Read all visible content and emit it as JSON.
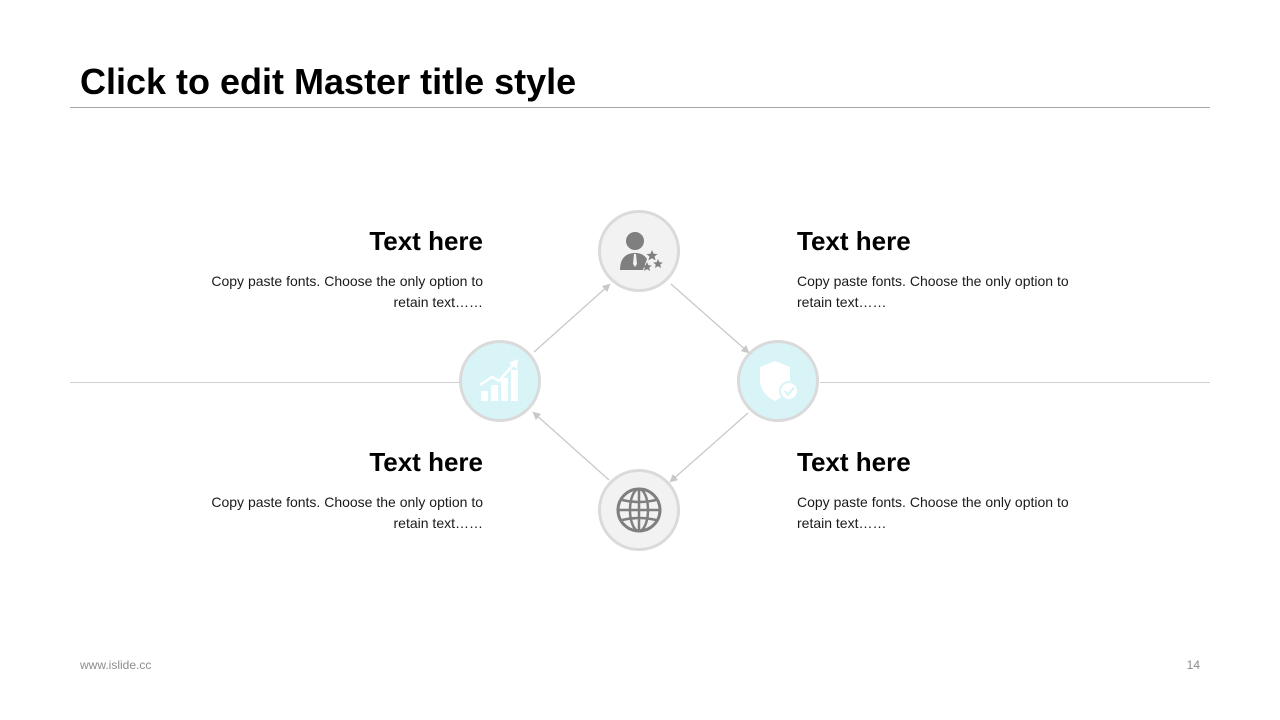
{
  "slide": {
    "title": "Click to edit Master title style"
  },
  "items": [
    {
      "heading": "Text here",
      "body": "Copy paste fonts. Choose the only option to retain text……",
      "icon": "user-stars-icon"
    },
    {
      "heading": "Text here",
      "body": "Copy paste fonts. Choose the only option to retain text……",
      "icon": "shield-check-icon"
    },
    {
      "heading": "Text here",
      "body": "Copy paste fonts. Choose the only option to retain text……",
      "icon": "growth-chart-icon"
    },
    {
      "heading": "Text here",
      "body": "Copy paste fonts. Choose the only option to retain text……",
      "icon": "globe-icon"
    }
  ],
  "colors": {
    "node_gray": "#f2f2f2",
    "node_cyan": "#d8f4f7",
    "node_border": "#dadada",
    "icon_gray": "#7f7f7f",
    "icon_white": "#ffffff",
    "rule": "#a6a6a6",
    "connector": "#c8c8c8"
  },
  "footer": {
    "url": "www.islide.cc",
    "page_number": "14"
  }
}
